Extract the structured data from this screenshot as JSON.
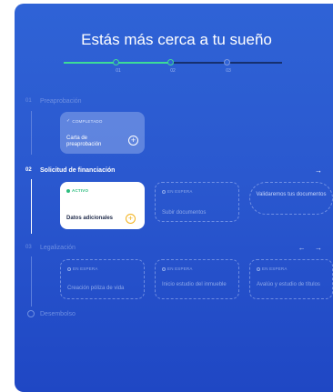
{
  "header": {
    "title": "Estás más cerca a tu sueño"
  },
  "progress": {
    "fraction": 0.5,
    "ticks": [
      "01",
      "02",
      "03"
    ]
  },
  "stages": [
    {
      "num": "01",
      "label": "Preaprobación",
      "state": "faded"
    },
    {
      "num": "02",
      "label": "Solicitud de financiación",
      "state": "active"
    },
    {
      "num": "03",
      "label": "Legalización",
      "state": "faded"
    },
    {
      "num": "",
      "label": "Desembolso",
      "state": "faded"
    }
  ],
  "stage1_cards": [
    {
      "badge": "COMPLETADO",
      "title": "Carta de preaprobación"
    }
  ],
  "stage2_cards": [
    {
      "badge": "ACTIVO",
      "title": "Datos adicionales"
    },
    {
      "badge": "EN ESPERA",
      "title": "Subir documentos"
    },
    {
      "badge": "",
      "title": "Validaremos tus documentos"
    }
  ],
  "stage3_cards": [
    {
      "badge": "EN ESPERA",
      "title": "Creación póliza de vida"
    },
    {
      "badge": "EN ESPERA",
      "title": "Inicio estudio del inmueble"
    },
    {
      "badge": "EN ESPERA",
      "title": "Avalúo y estudio de títulos"
    }
  ],
  "icons": {
    "arrow_right": "→",
    "arrow_left": "←",
    "plus": "+",
    "check": "✓"
  },
  "colors": {
    "background": "#2a58cf",
    "accent_green": "#3ddc97",
    "active_orange": "#f2b21c"
  }
}
